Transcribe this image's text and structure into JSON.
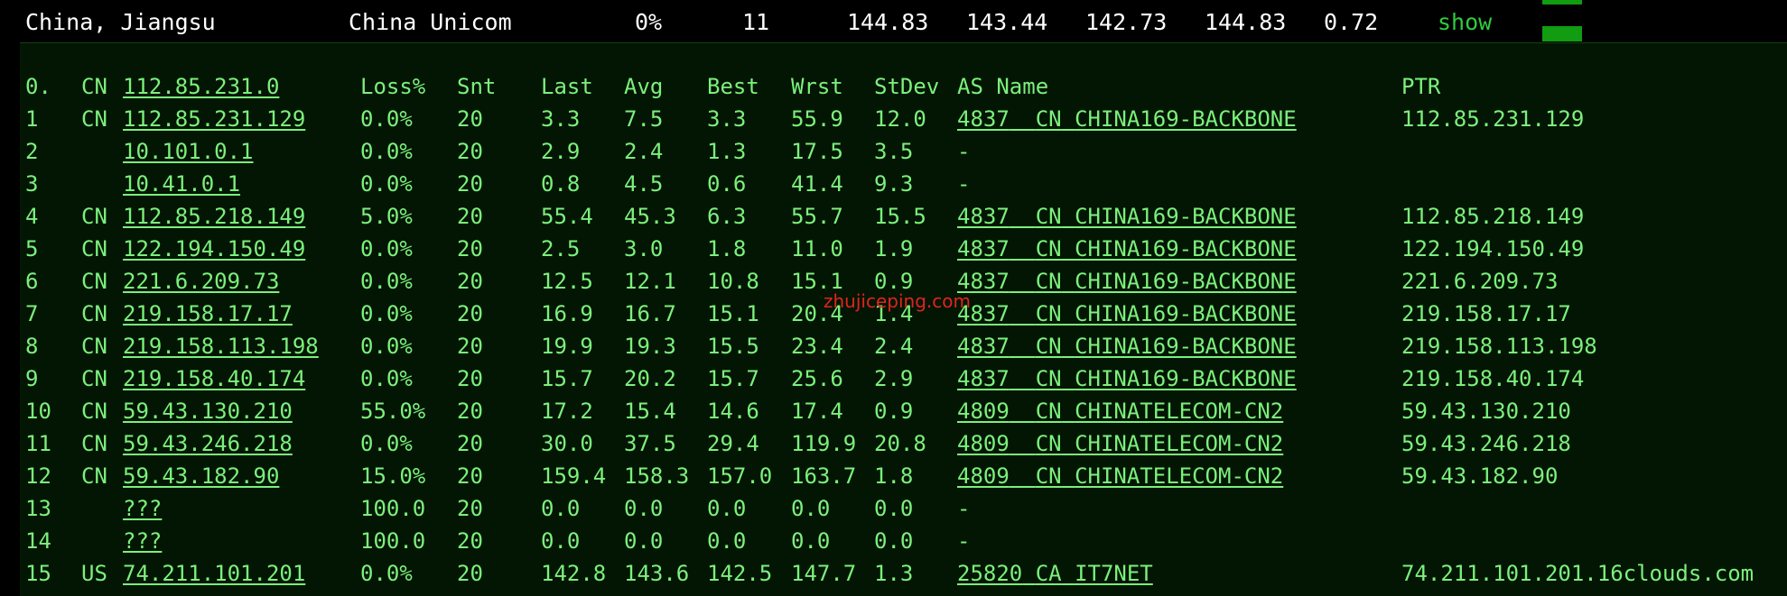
{
  "summary": {
    "location": "China, Jiangsu",
    "isp": "China Unicom",
    "loss": "0%",
    "count": "11",
    "v1": "144.83",
    "v2": "143.44",
    "v3": "142.73",
    "v4": "144.83",
    "v5": "0.72",
    "show_label": "show"
  },
  "header": {
    "idx": "0.",
    "cc": "CN",
    "host": "112.85.231.0",
    "loss": "Loss%",
    "snt": "Snt",
    "last": "Last",
    "avg": "Avg",
    "best": "Best",
    "wrst": "Wrst",
    "stdev": "StDev",
    "as_name": "AS Name",
    "ptr": "PTR"
  },
  "watermark": "zhujiceping.com",
  "hops": [
    {
      "idx": "1",
      "cc": "CN",
      "host": "112.85.231.129",
      "loss": "0.0%",
      "snt": "20",
      "last": "3.3",
      "avg": "7.5",
      "best": "3.3",
      "wrst": "55.9",
      "stdev": "12.0",
      "asn": "4837",
      "as_cc": "CN",
      "as_name": "CHINA169-BACKBONE",
      "ptr": "112.85.231.129"
    },
    {
      "idx": "2",
      "cc": "",
      "host": "10.101.0.1",
      "loss": "0.0%",
      "snt": "20",
      "last": "2.9",
      "avg": "2.4",
      "best": "1.3",
      "wrst": "17.5",
      "stdev": "3.5",
      "asn": "-",
      "as_cc": "",
      "as_name": "",
      "ptr": ""
    },
    {
      "idx": "3",
      "cc": "",
      "host": "10.41.0.1",
      "loss": "0.0%",
      "snt": "20",
      "last": "0.8",
      "avg": "4.5",
      "best": "0.6",
      "wrst": "41.4",
      "stdev": "9.3",
      "asn": "-",
      "as_cc": "",
      "as_name": "",
      "ptr": ""
    },
    {
      "idx": "4",
      "cc": "CN",
      "host": "112.85.218.149",
      "loss": "5.0%",
      "snt": "20",
      "last": "55.4",
      "avg": "45.3",
      "best": "6.3",
      "wrst": "55.7",
      "stdev": "15.5",
      "asn": "4837",
      "as_cc": "CN",
      "as_name": "CHINA169-BACKBONE",
      "ptr": "112.85.218.149"
    },
    {
      "idx": "5",
      "cc": "CN",
      "host": "122.194.150.49",
      "loss": "0.0%",
      "snt": "20",
      "last": "2.5",
      "avg": "3.0",
      "best": "1.8",
      "wrst": "11.0",
      "stdev": "1.9",
      "asn": "4837",
      "as_cc": "CN",
      "as_name": "CHINA169-BACKBONE",
      "ptr": "122.194.150.49"
    },
    {
      "idx": "6",
      "cc": "CN",
      "host": "221.6.209.73",
      "loss": "0.0%",
      "snt": "20",
      "last": "12.5",
      "avg": "12.1",
      "best": "10.8",
      "wrst": "15.1",
      "stdev": "0.9",
      "asn": "4837",
      "as_cc": "CN",
      "as_name": "CHINA169-BACKBONE",
      "ptr": "221.6.209.73"
    },
    {
      "idx": "7",
      "cc": "CN",
      "host": "219.158.17.17",
      "loss": "0.0%",
      "snt": "20",
      "last": "16.9",
      "avg": "16.7",
      "best": "15.1",
      "wrst": "20.4",
      "stdev": "1.4",
      "asn": "4837",
      "as_cc": "CN",
      "as_name": "CHINA169-BACKBONE",
      "ptr": "219.158.17.17"
    },
    {
      "idx": "8",
      "cc": "CN",
      "host": "219.158.113.198",
      "loss": "0.0%",
      "snt": "20",
      "last": "19.9",
      "avg": "19.3",
      "best": "15.5",
      "wrst": "23.4",
      "stdev": "2.4",
      "asn": "4837",
      "as_cc": "CN",
      "as_name": "CHINA169-BACKBONE",
      "ptr": "219.158.113.198"
    },
    {
      "idx": "9",
      "cc": "CN",
      "host": "219.158.40.174",
      "loss": "0.0%",
      "snt": "20",
      "last": "15.7",
      "avg": "20.2",
      "best": "15.7",
      "wrst": "25.6",
      "stdev": "2.9",
      "asn": "4837",
      "as_cc": "CN",
      "as_name": "CHINA169-BACKBONE",
      "ptr": "219.158.40.174"
    },
    {
      "idx": "10",
      "cc": "CN",
      "host": "59.43.130.210",
      "loss": "55.0%",
      "snt": "20",
      "last": "17.2",
      "avg": "15.4",
      "best": "14.6",
      "wrst": "17.4",
      "stdev": "0.9",
      "asn": "4809",
      "as_cc": "CN",
      "as_name": "CHINATELECOM-CN2",
      "ptr": "59.43.130.210"
    },
    {
      "idx": "11",
      "cc": "CN",
      "host": "59.43.246.218",
      "loss": "0.0%",
      "snt": "20",
      "last": "30.0",
      "avg": "37.5",
      "best": "29.4",
      "wrst": "119.9",
      "stdev": "20.8",
      "asn": "4809",
      "as_cc": "CN",
      "as_name": "CHINATELECOM-CN2",
      "ptr": "59.43.246.218"
    },
    {
      "idx": "12",
      "cc": "CN",
      "host": "59.43.182.90",
      "loss": "15.0%",
      "snt": "20",
      "last": "159.4",
      "avg": "158.3",
      "best": "157.0",
      "wrst": "163.7",
      "stdev": "1.8",
      "asn": "4809",
      "as_cc": "CN",
      "as_name": "CHINATELECOM-CN2",
      "ptr": "59.43.182.90"
    },
    {
      "idx": "13",
      "cc": "",
      "host": "???",
      "loss": "100.0",
      "snt": "20",
      "last": "0.0",
      "avg": "0.0",
      "best": "0.0",
      "wrst": "0.0",
      "stdev": "0.0",
      "asn": "-",
      "as_cc": "",
      "as_name": "",
      "ptr": ""
    },
    {
      "idx": "14",
      "cc": "",
      "host": "???",
      "loss": "100.0",
      "snt": "20",
      "last": "0.0",
      "avg": "0.0",
      "best": "0.0",
      "wrst": "0.0",
      "stdev": "0.0",
      "asn": "-",
      "as_cc": "",
      "as_name": "",
      "ptr": ""
    },
    {
      "idx": "15",
      "cc": "US",
      "host": "74.211.101.201",
      "loss": "0.0%",
      "snt": "20",
      "last": "142.8",
      "avg": "143.6",
      "best": "142.5",
      "wrst": "147.7",
      "stdev": "1.3",
      "asn": "25820",
      "as_cc": "CA",
      "as_name": "IT7NET",
      "ptr": "74.211.101.201.16clouds.com"
    }
  ]
}
